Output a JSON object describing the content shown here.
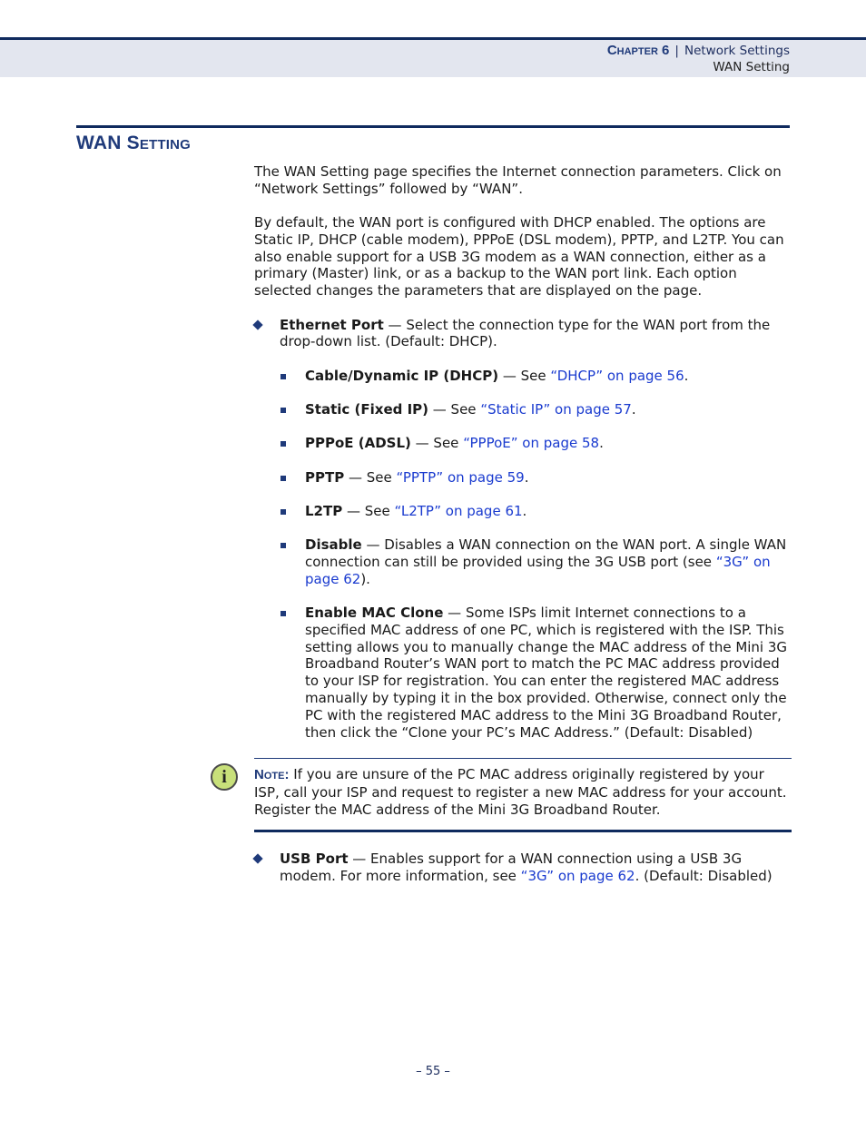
{
  "header": {
    "chapter": "Chapter 6",
    "separator": "|",
    "section": "Network Settings",
    "subsection": "WAN Setting"
  },
  "page_title": "WAN Setting",
  "intro": [
    "The WAN Setting page specifies the Internet connection parameters. Click on “Network Settings” followed by “WAN”.",
    "By default, the WAN port is configured with DHCP enabled. The options are Static IP, DHCP (cable modem), PPPoE (DSL modem), PPTP, and L2TP. You can also enable support for a USB 3G modem as a WAN connection, either as a primary (Master) link, or as a backup to the WAN port link. Each option selected changes the parameters that are displayed on the page."
  ],
  "ethernet_port": {
    "term": "Ethernet Port",
    "desc": " — Select the connection type for the WAN port from the drop-down list. (Default: DHCP)."
  },
  "options": [
    {
      "term": "Cable/Dynamic IP (DHCP)",
      "pre": " — See ",
      "link": "“DHCP” on page 56",
      "post": "."
    },
    {
      "term": "Static (Fixed IP)",
      "pre": " — See ",
      "link": "“Static IP” on page 57",
      "post": "."
    },
    {
      "term": "PPPoE (ADSL)",
      "pre": " — See ",
      "link": "“PPPoE” on page 58",
      "post": "."
    },
    {
      "term": "PPTP",
      "pre": " — See ",
      "link": "“PPTP” on page 59",
      "post": "."
    },
    {
      "term": "L2TP",
      "pre": " — See ",
      "link": "“L2TP” on page 61",
      "post": "."
    },
    {
      "term": "Disable",
      "pre": " — Disables a WAN connection on the WAN port. A single WAN connection can still be provided using the 3G USB port (see ",
      "link": "“3G” on page 62",
      "post": ")."
    },
    {
      "term": "Enable MAC Clone",
      "pre": " — Some ISPs limit Internet connections to a specified MAC address of one PC, which is registered with the ISP. This setting allows you to manually change the MAC address of the Mini 3G Broadband Router’s WAN port to match the PC MAC address provided to your ISP for registration. You can enter the registered MAC address manually by typing it in the box provided. Otherwise, connect only the PC with the registered MAC address to the Mini 3G Broadband Router, then click the “Clone your PC’s MAC Address.” (Default: Disabled)",
      "link": "",
      "post": ""
    }
  ],
  "note": {
    "icon": "info-icon",
    "label": "Note:",
    "text": " If you are unsure of the PC MAC address originally registered by your ISP, call your ISP and request to register a new MAC address for your account. Register the MAC address of the Mini 3G Broadband Router."
  },
  "usb_port": {
    "term": "USB Port",
    "pre": " — Enables support for a WAN connection using a USB 3G modem. For more information, see ",
    "link": "“3G” on page 62",
    "post": ". (Default: Disabled)"
  },
  "page_number": "–  55  –"
}
